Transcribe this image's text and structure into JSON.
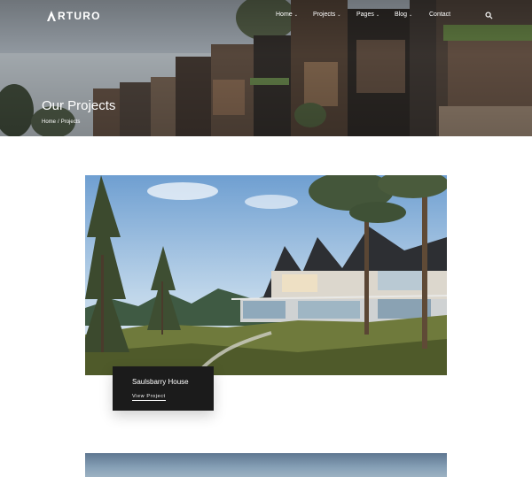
{
  "brand": {
    "logo_text": "RTURO",
    "logo_mark": "a-logo-mark"
  },
  "nav": {
    "items": [
      {
        "label": "Home",
        "has_dropdown": true
      },
      {
        "label": "Projects",
        "has_dropdown": true
      },
      {
        "label": "Pages",
        "has_dropdown": true
      },
      {
        "label": "Blog",
        "has_dropdown": true
      },
      {
        "label": "Contact",
        "has_dropdown": false
      }
    ],
    "chevron": "⌄",
    "search_icon": "search-icon"
  },
  "hero": {
    "title": "Our Projects",
    "breadcrumb": {
      "home": "Home",
      "separator": "/",
      "current": "Projects"
    }
  },
  "project": {
    "title": "Saulsbarry House",
    "link_label": "View Project"
  },
  "colors": {
    "caption_bg": "#1b1b1b",
    "text_light": "#ffffff",
    "page_bg": "#ffffff"
  }
}
